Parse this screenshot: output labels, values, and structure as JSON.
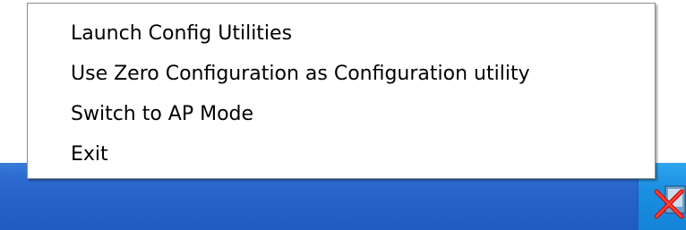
{
  "context_menu": {
    "items": [
      {
        "label": "Launch Config Utilities"
      },
      {
        "label": "Use Zero Configuration as Configuration utility"
      },
      {
        "label": "Switch to AP Mode"
      },
      {
        "label": "Exit"
      }
    ]
  },
  "taskbar": {
    "color": "#2563c9",
    "tray_color": "#1a8fe0",
    "tray_icon": "wireless-utility-icon"
  }
}
